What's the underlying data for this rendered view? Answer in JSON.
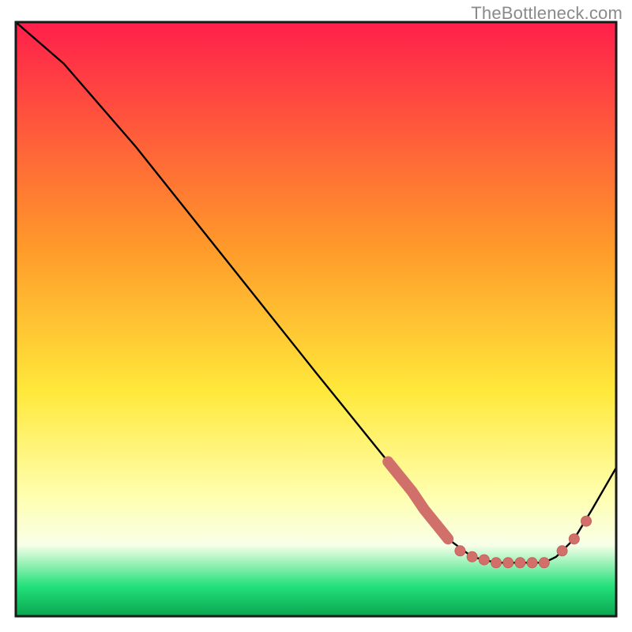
{
  "attribution": "TheBottleneck.com",
  "colors": {
    "gradient_top": "#ff1f4b",
    "gradient_mid_upper": "#ff9a2a",
    "gradient_mid": "#ffe83a",
    "gradient_lower": "#ffffb0",
    "gradient_band": "#f8ffe8",
    "gradient_bottom_hi": "#22e07a",
    "gradient_bottom_lo": "#0aa64f",
    "line": "#000000",
    "marker_fill": "#d1706a",
    "marker_stroke": "#c65f5a",
    "plot_bg": "#ffffff",
    "border": "#1a1a1a"
  },
  "chart_data": {
    "type": "line",
    "title": "",
    "xlabel": "",
    "ylabel": "",
    "xlim": [
      0,
      100
    ],
    "ylim": [
      0,
      100
    ],
    "grid": false,
    "legend": false,
    "series": [
      {
        "name": "curve",
        "x": [
          0,
          8,
          20,
          35,
          50,
          62,
          68,
          72,
          76,
          80,
          84,
          88,
          90,
          93,
          96,
          100
        ],
        "y": [
          100,
          93,
          79,
          60,
          41,
          26,
          18,
          13,
          10,
          9,
          9,
          9,
          10,
          13,
          18,
          25
        ]
      }
    ],
    "markers": {
      "name": "highlight",
      "segments": [
        {
          "type": "thick",
          "x": [
            62,
            64,
            66,
            68,
            70,
            72
          ],
          "y": [
            26,
            23.5,
            21,
            18,
            15.5,
            13
          ]
        },
        {
          "type": "dots",
          "x": [
            74,
            76,
            78,
            80,
            82,
            84,
            86,
            88
          ],
          "y": [
            11,
            10,
            9.5,
            9,
            9,
            9,
            9,
            9
          ]
        },
        {
          "type": "sparse-dots",
          "x": [
            91,
            93,
            95
          ],
          "y": [
            11,
            13,
            16
          ]
        }
      ]
    }
  }
}
